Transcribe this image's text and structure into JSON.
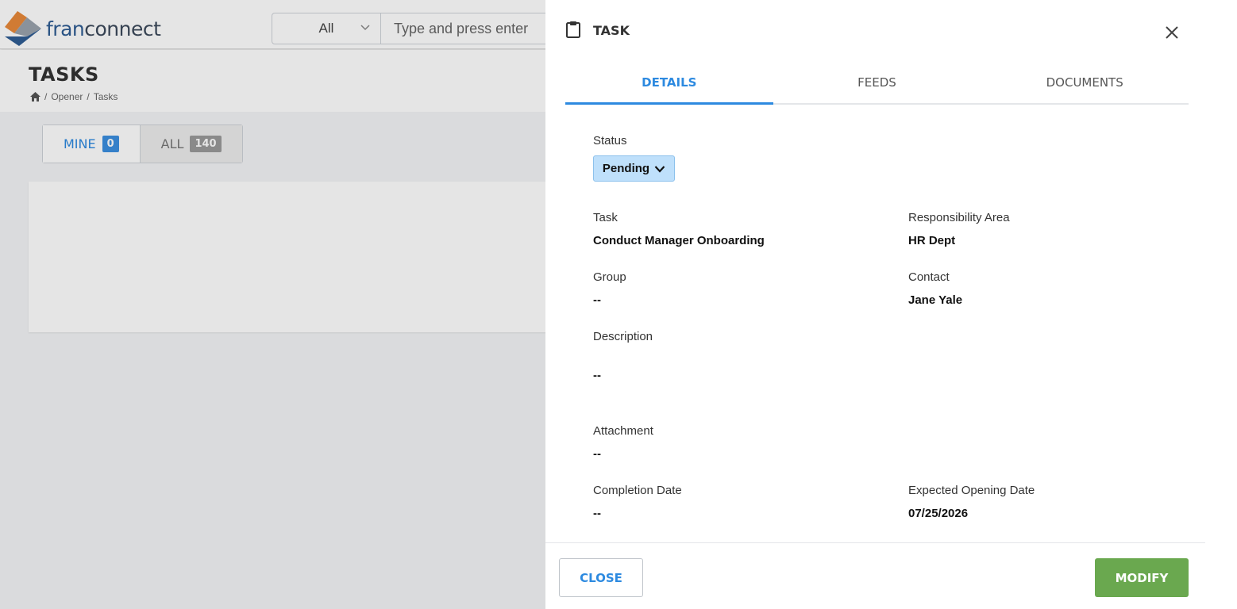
{
  "app": {
    "logo": {
      "part1": "fran",
      "part2": "connect"
    },
    "search": {
      "scope": "All",
      "placeholder": "Type and press enter"
    },
    "page": {
      "title": "TASKS",
      "breadcrumb": [
        "Opener",
        "Tasks"
      ]
    },
    "filter": {
      "mine_label": "MINE",
      "mine_count": "0",
      "all_label": "ALL",
      "all_count": "140"
    }
  },
  "drawer": {
    "title": "TASK",
    "tabs": [
      {
        "label": "DETAILS",
        "active": true
      },
      {
        "label": "FEEDS",
        "active": false
      },
      {
        "label": "DOCUMENTS",
        "active": false
      }
    ],
    "status": {
      "label": "Status",
      "value": "Pending"
    },
    "fields": {
      "task": {
        "label": "Task",
        "value": "Conduct Manager Onboarding"
      },
      "responsibility": {
        "label": "Responsibility Area",
        "value": "HR Dept"
      },
      "group": {
        "label": "Group",
        "value": "--"
      },
      "contact": {
        "label": "Contact",
        "value": "Jane Yale"
      },
      "description": {
        "label": "Description",
        "value": "--"
      },
      "attachment": {
        "label": "Attachment",
        "value": "--"
      },
      "completion_date": {
        "label": "Completion Date",
        "value": "--"
      },
      "expected_opening": {
        "label": "Expected Opening Date",
        "value": "07/25/2026"
      }
    },
    "footer": {
      "close_label": "CLOSE",
      "modify_label": "MODIFY"
    }
  },
  "colors": {
    "accent": "#2d8ae0",
    "status_bg": "#bfe0fb",
    "modify_green": "#6aa84f"
  }
}
